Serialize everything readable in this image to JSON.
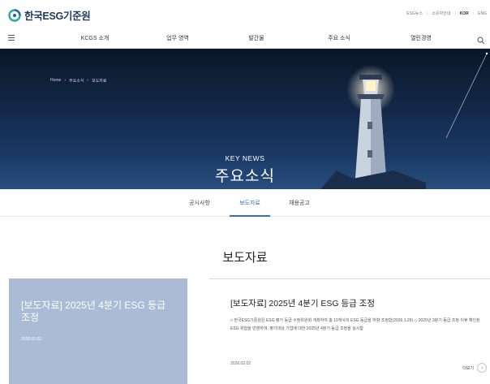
{
  "header": {
    "logo_text": "한국ESG기준원",
    "util_links": [
      "ESG뉴스",
      "소유자안내",
      "KOR",
      "ENG"
    ]
  },
  "nav": {
    "items": [
      "KCGS 소개",
      "업무 영역",
      "발간물",
      "주요 소식",
      "열린경영"
    ]
  },
  "hero": {
    "breadcrumb": [
      "Home",
      "주요소식",
      "보도자료"
    ],
    "kicker": "KEY NEWS",
    "title": "주요소식"
  },
  "tabs": {
    "items": [
      "공시사항",
      "보도자료",
      "채용공고"
    ],
    "active_index": 1
  },
  "section": {
    "title": "보도자료"
  },
  "feature_card": {
    "title": "[보도자료] 2025년 4분기 ESG 등급 조정",
    "date": "2026.02.02"
  },
  "article": {
    "title": "[보도자료] 2025년 4분기 ESG 등급 조정",
    "body": "□ 한국ESG기준원은 ESG 평가 등급 수정위원회 개최하여 총 10개사의 ESG 등급을 하향 조정함(2026.1.29) ◇ 2025년 3분기 등급 조정 이후 확인된 ESG 위험을 반영하여, 평가대상 기업에 대한 2025년 4분기 등급 조정을 실시함",
    "date": "2026.02.02",
    "more_label": "더보기"
  },
  "colors": {
    "accent": "#3b6fb0",
    "card_bg": "#a9bbd5",
    "hero_dark": "#0b1729"
  }
}
